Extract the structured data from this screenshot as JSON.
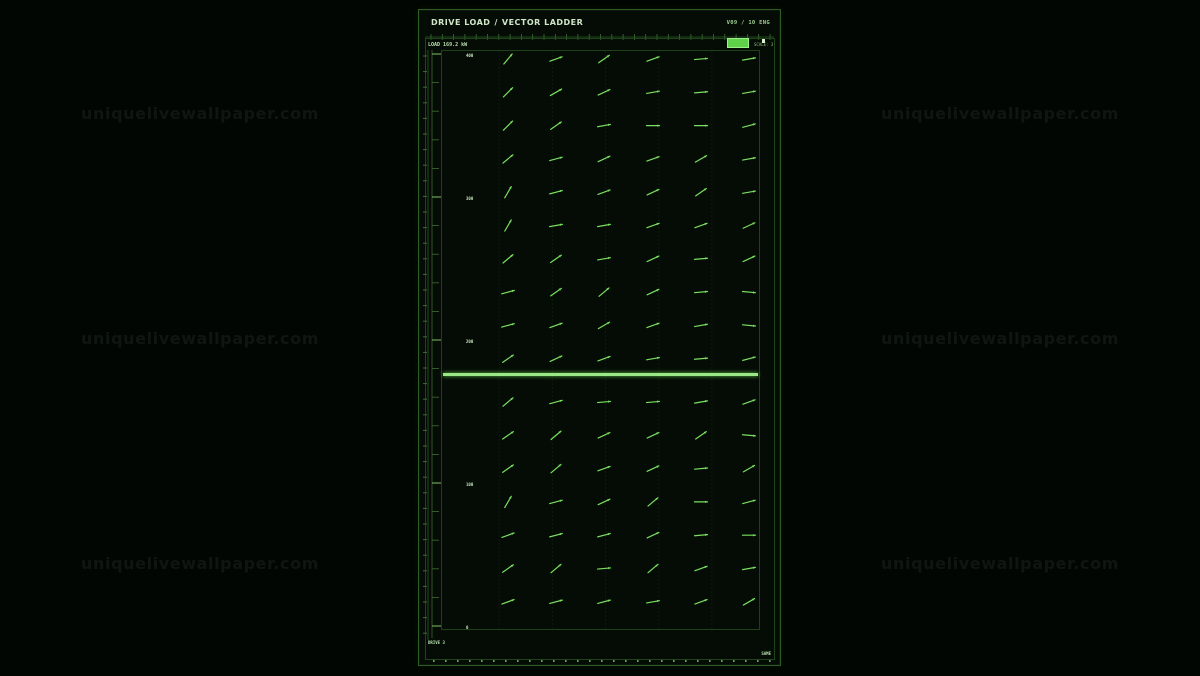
{
  "watermark": {
    "text": "uniquelivewallpaper.com",
    "rows": 3,
    "columns": 3
  },
  "header": {
    "title_left": "DRIVE LOAD",
    "separator": "/",
    "title_right": "VECTOR LADDER",
    "page_indicator": "V09 / 10  ENG"
  },
  "readout": {
    "label": "LOAD",
    "value": "169.2 kW"
  },
  "scale_control": {
    "label": "SCALE: 3",
    "active": true
  },
  "gauge": {
    "tick_labels": [
      "400",
      "300",
      "200",
      "100",
      "0"
    ]
  },
  "footer": {
    "left_label": "DRIVE 3",
    "right_label": "SAME"
  },
  "colors": {
    "accent": "#5fd24a",
    "arrow": "#79e060",
    "frame": "#2e5a26",
    "background": "#020602",
    "text": "#cfe6c8"
  },
  "vector_field": {
    "columns": 6,
    "rows": 18,
    "angles_deg": [
      [
        50,
        20,
        35,
        20,
        5,
        10
      ],
      [
        45,
        30,
        25,
        10,
        5,
        10
      ],
      [
        45,
        35,
        10,
        0,
        0,
        15
      ],
      [
        40,
        15,
        25,
        20,
        30,
        10
      ],
      [
        60,
        15,
        20,
        25,
        35,
        10
      ],
      [
        60,
        10,
        10,
        20,
        20,
        25
      ],
      [
        40,
        35,
        10,
        25,
        5,
        25
      ],
      [
        15,
        35,
        40,
        25,
        5,
        -5
      ],
      [
        15,
        20,
        30,
        20,
        10,
        -5
      ],
      [
        35,
        25,
        20,
        10,
        5,
        15
      ],
      [
        40,
        15,
        5,
        5,
        10,
        20
      ],
      [
        35,
        40,
        25,
        25,
        35,
        -5
      ],
      [
        35,
        40,
        20,
        25,
        5,
        30
      ],
      [
        60,
        15,
        25,
        40,
        0,
        15
      ],
      [
        20,
        15,
        15,
        25,
        5,
        0
      ],
      [
        35,
        40,
        5,
        40,
        20,
        10
      ],
      [
        20,
        15,
        15,
        10,
        20,
        30
      ],
      [
        20,
        15,
        15,
        10,
        20,
        10
      ]
    ]
  }
}
